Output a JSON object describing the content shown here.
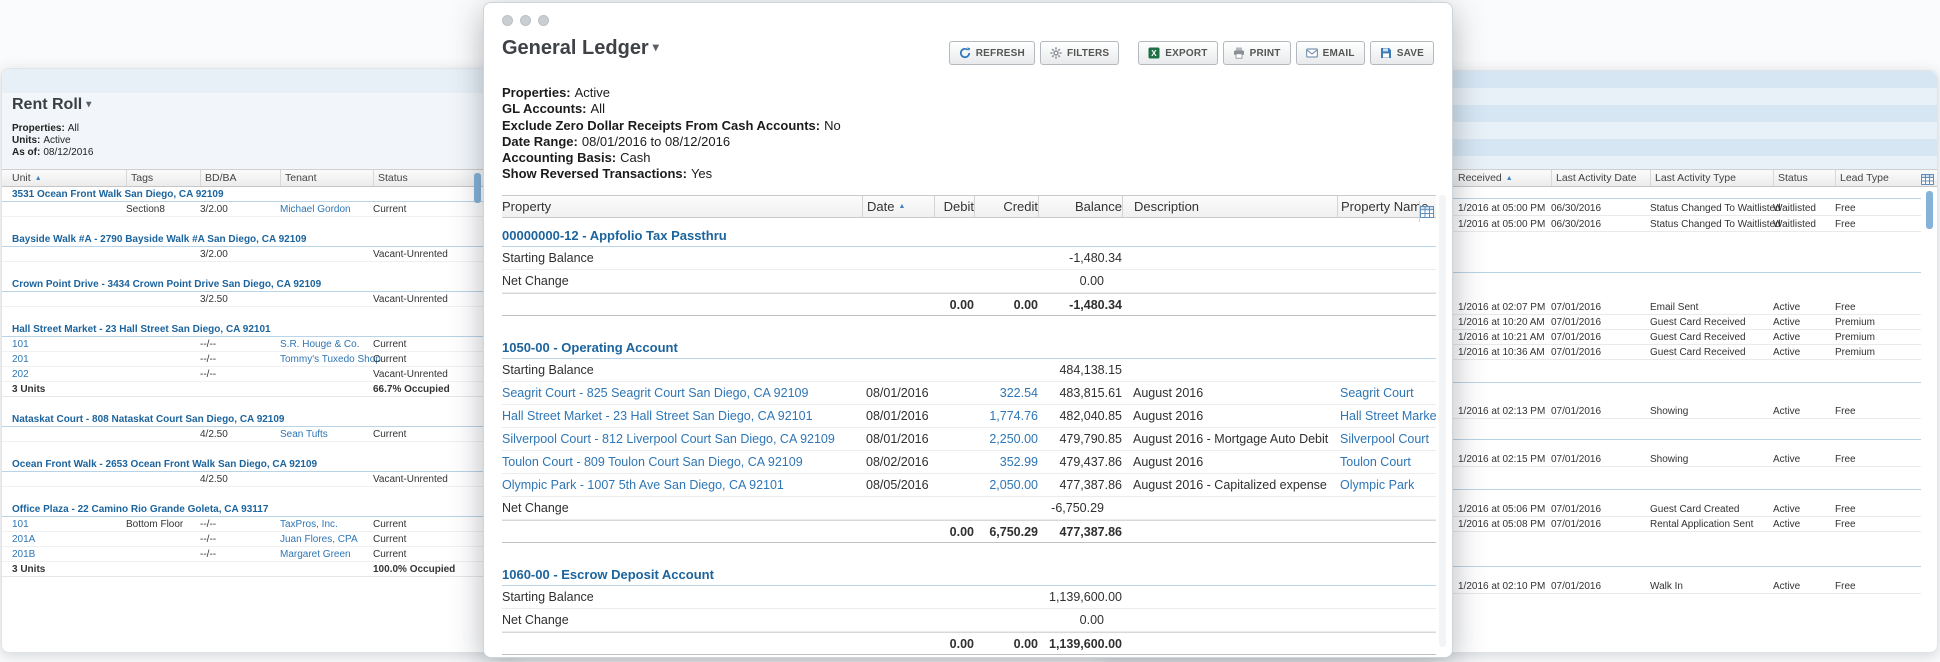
{
  "icons": {
    "sort_asc": "▲",
    "caret_down": "▾"
  },
  "rent_roll": {
    "title": "Rent Roll",
    "params": [
      {
        "label": "Properties:",
        "value": "All"
      },
      {
        "label": "Units:",
        "value": "Active"
      },
      {
        "label": "As of:",
        "value": "08/12/2016"
      }
    ],
    "columns": {
      "unit": "Unit",
      "tags": "Tags",
      "bdba": "BD/BA",
      "tenant": "Tenant",
      "status": "Status"
    },
    "rows": [
      {
        "type": "group",
        "label": "3531 Ocean Front Walk San Diego, CA 92109"
      },
      {
        "type": "data",
        "unit": "",
        "tags": "Section8",
        "bdba": "3/2.00",
        "tenant": "Michael Gordon",
        "status": "Current"
      },
      {
        "type": "spacer"
      },
      {
        "type": "group",
        "label": "Bayside Walk #A - 2790 Bayside Walk #A San Diego, CA 92109"
      },
      {
        "type": "data",
        "unit": "",
        "tags": "",
        "bdba": "3/2.00",
        "tenant": "",
        "status": "Vacant-Unrented"
      },
      {
        "type": "spacer"
      },
      {
        "type": "group",
        "label": "Crown Point Drive - 3434 Crown Point Drive San Diego, CA 92109"
      },
      {
        "type": "data",
        "unit": "",
        "tags": "",
        "bdba": "3/2.50",
        "tenant": "",
        "status": "Vacant-Unrented"
      },
      {
        "type": "spacer"
      },
      {
        "type": "group",
        "label": "Hall Street Market - 23 Hall Street San Diego, CA 92101"
      },
      {
        "type": "data",
        "unit": "101",
        "tags": "",
        "bdba": "--/--",
        "tenant": "S.R. Houge & Co.",
        "status": "Current"
      },
      {
        "type": "data",
        "unit": "201",
        "tags": "",
        "bdba": "--/--",
        "tenant": "Tommy's Tuxedo Shop",
        "status": "Current"
      },
      {
        "type": "data",
        "unit": "202",
        "tags": "",
        "bdba": "--/--",
        "tenant": "",
        "status": "Vacant-Unrented"
      },
      {
        "type": "summary",
        "unit": "3 Units",
        "status": "66.7% Occupied"
      },
      {
        "type": "spacer"
      },
      {
        "type": "group",
        "label": "Nataskat Court - 808 Nataskat Court San Diego, CA 92109"
      },
      {
        "type": "data",
        "unit": "",
        "tags": "",
        "bdba": "4/2.50",
        "tenant": "Sean Tufts",
        "status": "Current"
      },
      {
        "type": "spacer"
      },
      {
        "type": "group",
        "label": "Ocean Front Walk - 2653 Ocean Front Walk San Diego, CA 92109"
      },
      {
        "type": "data",
        "unit": "",
        "tags": "",
        "bdba": "4/2.50",
        "tenant": "",
        "status": "Vacant-Unrented"
      },
      {
        "type": "spacer"
      },
      {
        "type": "group",
        "label": "Office Plaza - 22 Camino Rio Grande Goleta, CA 93117"
      },
      {
        "type": "data",
        "unit": "101",
        "tags": "Bottom Floor",
        "bdba": "--/--",
        "tenant": "TaxPros, Inc.",
        "status": "Current"
      },
      {
        "type": "data",
        "unit": "201A",
        "tags": "",
        "bdba": "--/--",
        "tenant": "Juan Flores, CPA",
        "status": "Current"
      },
      {
        "type": "data",
        "unit": "201B",
        "tags": "",
        "bdba": "--/--",
        "tenant": "Margaret Green",
        "status": "Current"
      },
      {
        "type": "summary",
        "unit": "3 Units",
        "status": "100.0% Occupied"
      }
    ]
  },
  "general_ledger": {
    "title": "General Ledger",
    "toolbar": [
      {
        "id": "refresh",
        "label": "REFRESH"
      },
      {
        "id": "filters",
        "label": "FILTERS"
      },
      {
        "id": "export",
        "label": "EXPORT"
      },
      {
        "id": "print",
        "label": "PRINT"
      },
      {
        "id": "email",
        "label": "EMAIL"
      },
      {
        "id": "save",
        "label": "SAVE"
      }
    ],
    "params": [
      {
        "label": "Properties:",
        "value": "Active"
      },
      {
        "label": "GL Accounts:",
        "value": "All"
      },
      {
        "label": "Exclude Zero Dollar Receipts From Cash Accounts:",
        "value": "No"
      },
      {
        "label": "Date Range:",
        "value": "08/01/2016 to 08/12/2016"
      },
      {
        "label": "Accounting Basis:",
        "value": "Cash"
      },
      {
        "label": "Show Reversed Transactions:",
        "value": "Yes"
      }
    ],
    "columns": {
      "property": "Property",
      "date": "Date",
      "debit": "Debit",
      "credit": "Credit",
      "balance": "Balance",
      "description": "Description",
      "property_name": "Property Name"
    },
    "row_labels": {
      "starting": "Starting Balance",
      "net": "Net Change"
    },
    "rows": [
      {
        "type": "section",
        "label": "00000000-12 - Appfolio Tax Passthru"
      },
      {
        "type": "starting",
        "balance": "-1,480.34"
      },
      {
        "type": "net",
        "balance": "0.00"
      },
      {
        "type": "total",
        "debit": "0.00",
        "credit": "0.00",
        "balance": "-1,480.34"
      },
      {
        "type": "gap"
      },
      {
        "type": "section",
        "label": "1050-00 - Operating Account"
      },
      {
        "type": "starting",
        "balance": "484,138.15"
      },
      {
        "type": "txn",
        "property": "Seagrit Court - 825 Seagrit Court San Diego, CA 92109",
        "date": "08/01/2016",
        "debit": "",
        "credit": "322.54",
        "balance": "483,815.61",
        "description": "August 2016",
        "property_name": "Seagrit Court"
      },
      {
        "type": "txn",
        "property": "Hall Street Market - 23 Hall Street San Diego, CA 92101",
        "date": "08/01/2016",
        "debit": "",
        "credit": "1,774.76",
        "balance": "482,040.85",
        "description": "August 2016",
        "property_name": "Hall Street Market"
      },
      {
        "type": "txn",
        "property": "Silverpool Court - 812 Liverpool Court San Diego, CA 92109",
        "date": "08/01/2016",
        "debit": "",
        "credit": "2,250.00",
        "balance": "479,790.85",
        "description": "August 2016 - Mortgage Auto Debit",
        "property_name": "Silverpool Court"
      },
      {
        "type": "txn",
        "property": "Toulon Court - 809 Toulon Court San Diego, CA 92109",
        "date": "08/02/2016",
        "debit": "",
        "credit": "352.99",
        "balance": "479,437.86",
        "description": "August 2016",
        "property_name": "Toulon Court"
      },
      {
        "type": "txn",
        "property": "Olympic Park - 1007 5th Ave San Diego, CA 92101",
        "date": "08/05/2016",
        "debit": "",
        "credit": "2,050.00",
        "balance": "477,387.86",
        "description": "August 2016 - Capitalized expense",
        "property_name": "Olympic Park"
      },
      {
        "type": "net",
        "balance": "-6,750.29"
      },
      {
        "type": "total",
        "debit": "0.00",
        "credit": "6,750.29",
        "balance": "477,387.86"
      },
      {
        "type": "gap"
      },
      {
        "type": "section",
        "label": "1060-00 - Escrow Deposit Account"
      },
      {
        "type": "starting",
        "balance": "1,139,600.00"
      },
      {
        "type": "net",
        "balance": "0.00"
      },
      {
        "type": "total",
        "debit": "0.00",
        "credit": "0.00",
        "balance": "1,139,600.00"
      }
    ]
  },
  "guest_activity": {
    "columns": {
      "received": "Received",
      "last_activity_date": "Last Activity Date",
      "last_activity_type": "Last Activity Type",
      "status": "Status",
      "lead_type": "Lead Type"
    },
    "rows": [
      {
        "received": "1/2016 at 05:00 PM",
        "last_activity_date": "06/30/2016",
        "last_activity_type": "Status Changed To Waitlisted",
        "status": "Waitlisted",
        "lead_type": "Free"
      },
      {
        "received": "1/2016 at 05:00 PM",
        "last_activity_date": "06/30/2016",
        "last_activity_type": "Status Changed To Waitlisted",
        "status": "Waitlisted",
        "lead_type": "Free"
      },
      {
        "received": "1/2016 at 02:07 PM",
        "last_activity_date": "07/01/2016",
        "last_activity_type": "Email Sent",
        "status": "Active",
        "lead_type": "Free"
      },
      {
        "received": "1/2016 at 10:20 AM",
        "last_activity_date": "07/01/2016",
        "last_activity_type": "Guest Card Received",
        "status": "Active",
        "lead_type": "Premium"
      },
      {
        "received": "1/2016 at 10:21 AM",
        "last_activity_date": "07/01/2016",
        "last_activity_type": "Guest Card Received",
        "status": "Active",
        "lead_type": "Premium"
      },
      {
        "received": "1/2016 at 10:36 AM",
        "last_activity_date": "07/01/2016",
        "last_activity_type": "Guest Card Received",
        "status": "Active",
        "lead_type": "Premium"
      },
      {
        "received": "1/2016 at 02:13 PM",
        "last_activity_date": "07/01/2016",
        "last_activity_type": "Showing",
        "status": "Active",
        "lead_type": "Free"
      },
      {
        "received": "1/2016 at 02:15 PM",
        "last_activity_date": "07/01/2016",
        "last_activity_type": "Showing",
        "status": "Active",
        "lead_type": "Free"
      },
      {
        "received": "1/2016 at 05:06 PM",
        "last_activity_date": "07/01/2016",
        "last_activity_type": "Guest Card Created",
        "status": "Active",
        "lead_type": "Free"
      },
      {
        "received": "1/2016 at 05:08 PM",
        "last_activity_date": "07/01/2016",
        "last_activity_type": "Rental Application Sent",
        "status": "Active",
        "lead_type": "Free"
      },
      {
        "received": "1/2016 at 02:10 PM",
        "last_activity_date": "07/01/2016",
        "last_activity_type": "Walk In",
        "status": "Active",
        "lead_type": "Free"
      }
    ]
  }
}
